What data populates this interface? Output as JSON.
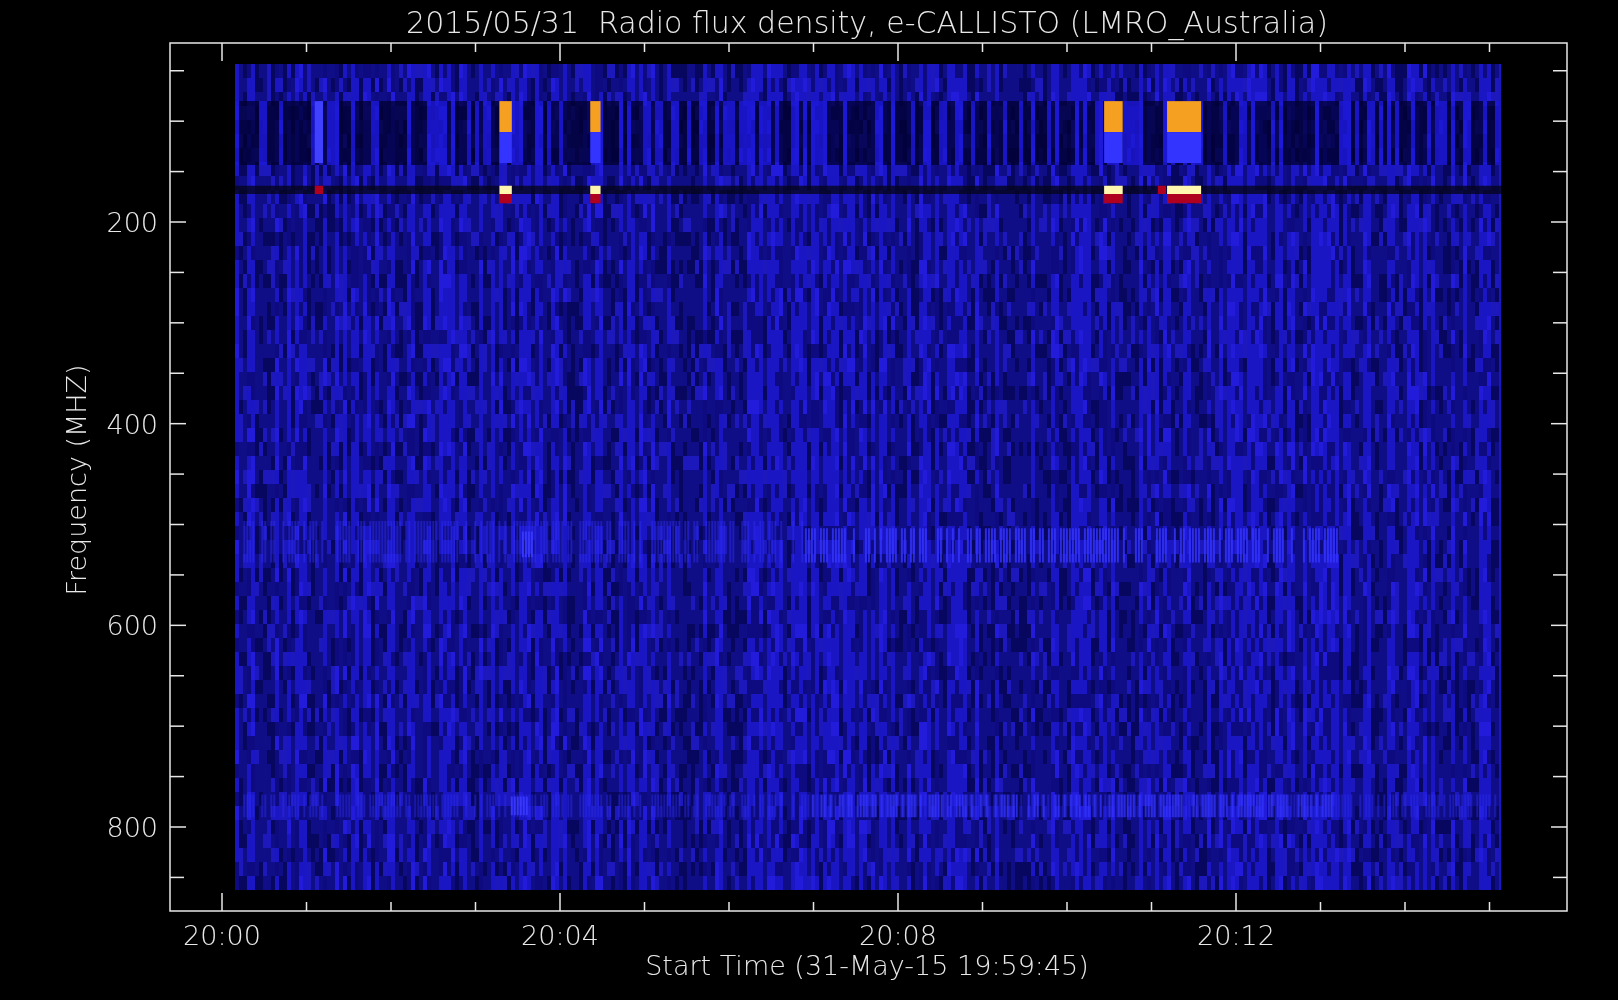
{
  "title": "2015/05/31  Radio flux density, e-CALLISTO (LMRO_Australia)",
  "plot": {
    "ylabel": "Frequency (MHZ)",
    "xlabel": "Start Time (31-May-15 19:59:45)",
    "yticks": [
      {
        "label": "200"
      },
      {
        "label": "400"
      },
      {
        "label": "600"
      },
      {
        "label": "800"
      }
    ],
    "xticks": [
      {
        "label": "20:00"
      },
      {
        "label": "20:04"
      },
      {
        "label": "20:08"
      },
      {
        "label": "20:12"
      }
    ]
  }
}
